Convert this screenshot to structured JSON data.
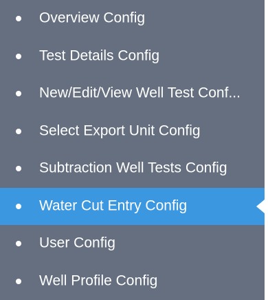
{
  "menu": {
    "items": [
      {
        "label": "Overview Config",
        "active": false
      },
      {
        "label": "Test Details Config",
        "active": false
      },
      {
        "label": "New/Edit/View Well Test Conf...",
        "active": false
      },
      {
        "label": "Select Export Unit Config",
        "active": false
      },
      {
        "label": "Subtraction Well Tests Config",
        "active": false
      },
      {
        "label": "Water Cut Entry Config",
        "active": true
      },
      {
        "label": "User Config",
        "active": false
      },
      {
        "label": "Well Profile Config",
        "active": false
      }
    ]
  },
  "colors": {
    "panel_background": "#656f7f",
    "active_background": "#3b97df",
    "text": "#ffffff"
  }
}
